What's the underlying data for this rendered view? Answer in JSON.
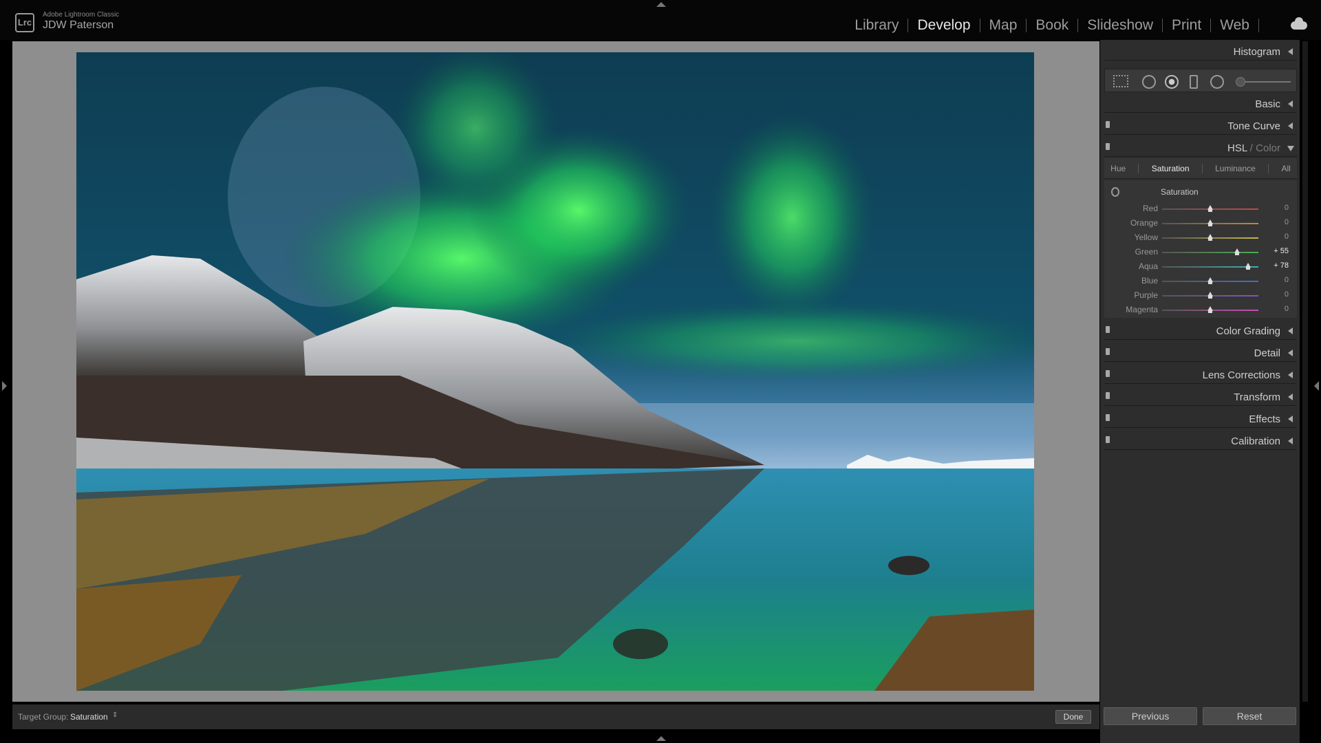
{
  "app": {
    "logo": "Lrc",
    "name": "Adobe Lightroom Classic",
    "user": "JDW Paterson"
  },
  "modules": [
    {
      "label": "Library",
      "active": false
    },
    {
      "label": "Develop",
      "active": true
    },
    {
      "label": "Map",
      "active": false
    },
    {
      "label": "Book",
      "active": false
    },
    {
      "label": "Slideshow",
      "active": false
    },
    {
      "label": "Print",
      "active": false
    },
    {
      "label": "Web",
      "active": false
    }
  ],
  "toolbar": {
    "target_label": "Target Group:",
    "target_value": "Saturation",
    "done": "Done"
  },
  "panels": {
    "histogram": "Histogram",
    "basic": "Basic",
    "tone_curve": "Tone Curve",
    "hsl": {
      "main": "HSL",
      "sep": " / ",
      "alt": "Color"
    },
    "color_grading": "Color Grading",
    "detail": "Detail",
    "lens": "Lens Corrections",
    "transform": "Transform",
    "effects": "Effects",
    "calibration": "Calibration"
  },
  "hsl_tabs": [
    "Hue",
    "Saturation",
    "Luminance",
    "All"
  ],
  "hsl_active_tab": "Saturation",
  "saturation": {
    "title": "Saturation",
    "range": [
      -100,
      100
    ],
    "sliders": [
      {
        "name": "Red",
        "value": 0,
        "display": "0",
        "color": "#c24a4a"
      },
      {
        "name": "Orange",
        "value": 0,
        "display": "0",
        "color": "#c9843f"
      },
      {
        "name": "Yellow",
        "value": 0,
        "display": "0",
        "color": "#c8b845"
      },
      {
        "name": "Green",
        "value": 55,
        "display": "+ 55",
        "color": "#4caf50"
      },
      {
        "name": "Aqua",
        "value": 78,
        "display": "+ 78",
        "color": "#3fb0b0"
      },
      {
        "name": "Blue",
        "value": 0,
        "display": "0",
        "color": "#3f6fc8"
      },
      {
        "name": "Purple",
        "value": 0,
        "display": "0",
        "color": "#8a4fc8"
      },
      {
        "name": "Magenta",
        "value": 0,
        "display": "0",
        "color": "#c84fb0"
      }
    ]
  },
  "buttons": {
    "previous": "Previous",
    "reset": "Reset"
  },
  "icons": [
    "crop-icon",
    "spot-removal-icon",
    "red-eye-icon",
    "graduated-filter-icon",
    "radial-filter-icon",
    "adjustment-brush-icon",
    "cloud-icon",
    "target-adjustment-icon"
  ]
}
